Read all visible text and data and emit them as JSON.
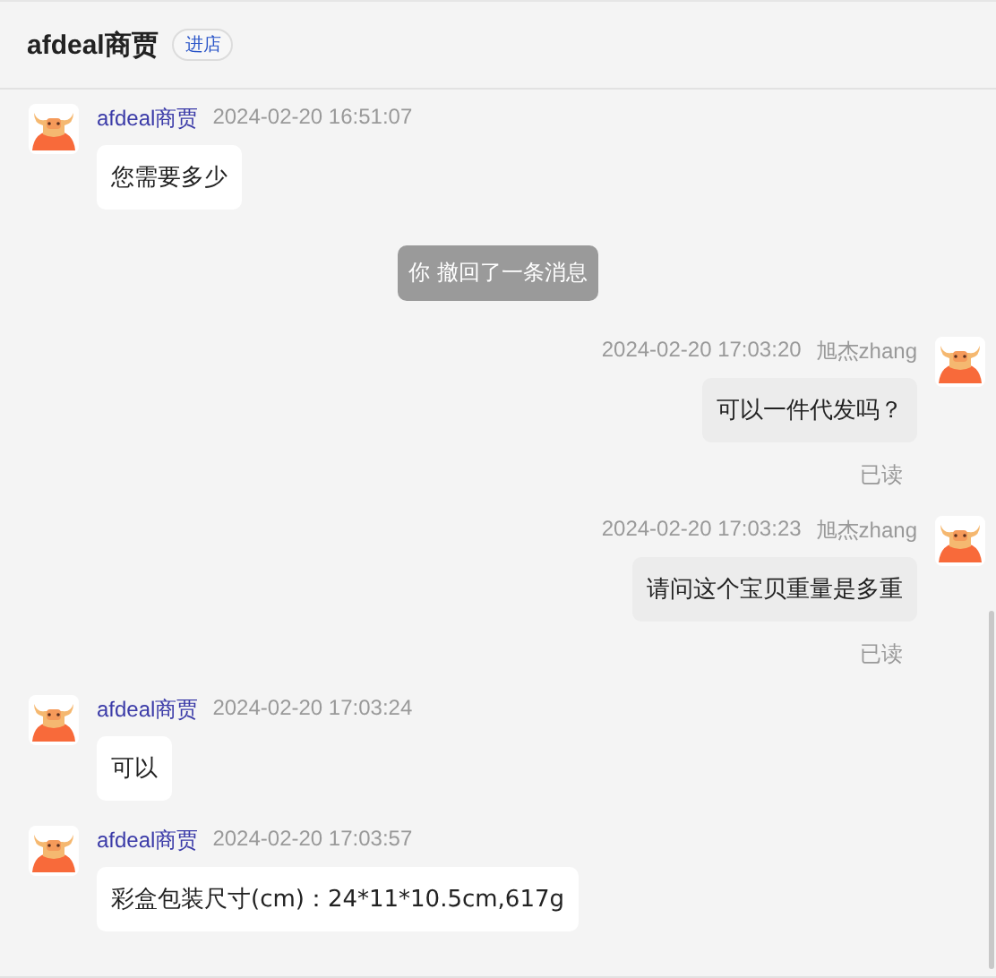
{
  "header": {
    "title": "afdeal商贾",
    "badge": "进店"
  },
  "messages": [
    {
      "kind": "incoming",
      "sender": "afdeal商贾",
      "time": "2024-02-20 16:51:07",
      "text": "您需要多少"
    },
    {
      "kind": "system",
      "text": "你 撤回了一条消息"
    },
    {
      "kind": "outgoing",
      "sender": "旭杰zhang",
      "time": "2024-02-20 17:03:20",
      "text": "可以一件代发吗？",
      "status": "已读"
    },
    {
      "kind": "outgoing",
      "sender": "旭杰zhang",
      "time": "2024-02-20 17:03:23",
      "text": "请问这个宝贝重量是多重",
      "status": "已读"
    },
    {
      "kind": "incoming",
      "sender": "afdeal商贾",
      "time": "2024-02-20 17:03:24",
      "text": "可以"
    },
    {
      "kind": "incoming",
      "sender": "afdeal商贾",
      "time": "2024-02-20 17:03:57",
      "text": "彩盒包装尺寸(cm)：24*11*10.5cm,617g"
    }
  ]
}
